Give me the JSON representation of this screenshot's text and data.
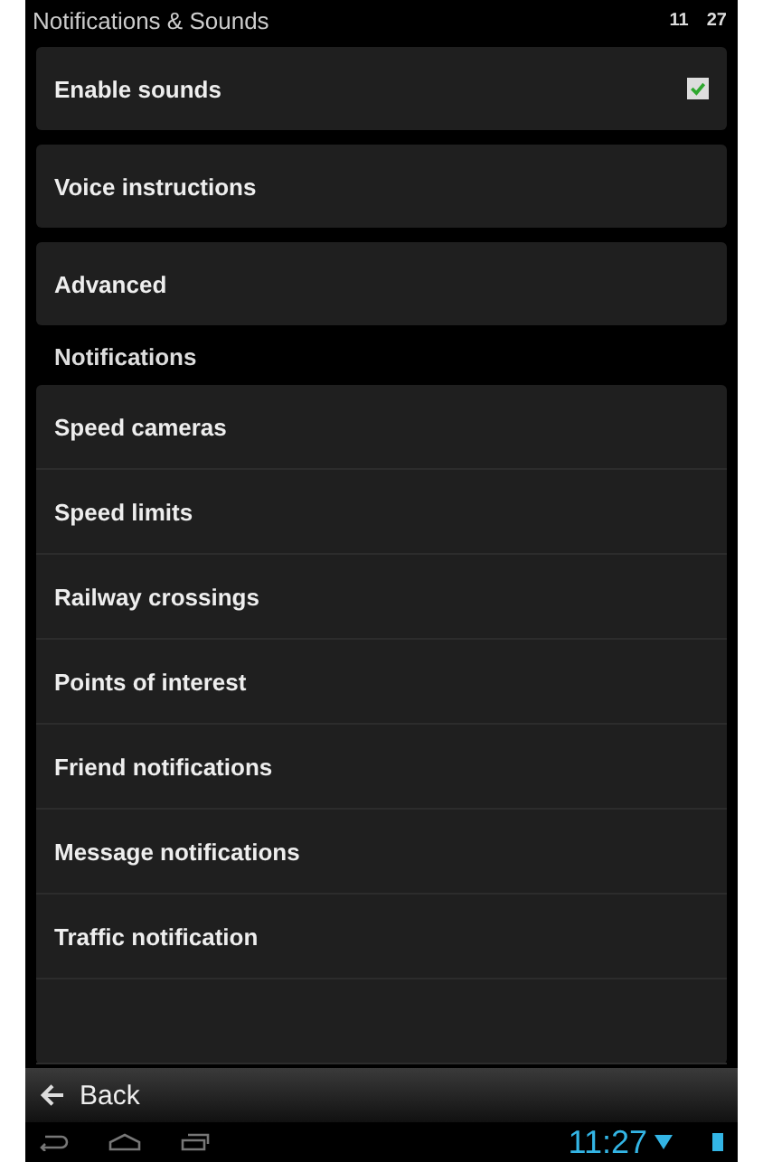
{
  "status_bar": {
    "title": "Notifications & Sounds",
    "hours": "11",
    "minutes": "27"
  },
  "settings": [
    {
      "label": "Enable sounds",
      "kind": "checkbox",
      "checked": true
    },
    {
      "label": "Voice instructions",
      "kind": "link"
    },
    {
      "label": "Advanced",
      "kind": "link"
    }
  ],
  "notifications": {
    "title": "Notifications",
    "items": [
      "Speed cameras",
      "Speed limits",
      "Railway crossings",
      "Points of interest",
      "Friend notifications",
      "Message notifications",
      "Traffic notification"
    ]
  },
  "back_button": {
    "label": "Back"
  },
  "nav_bar": {
    "time": "11:27"
  }
}
